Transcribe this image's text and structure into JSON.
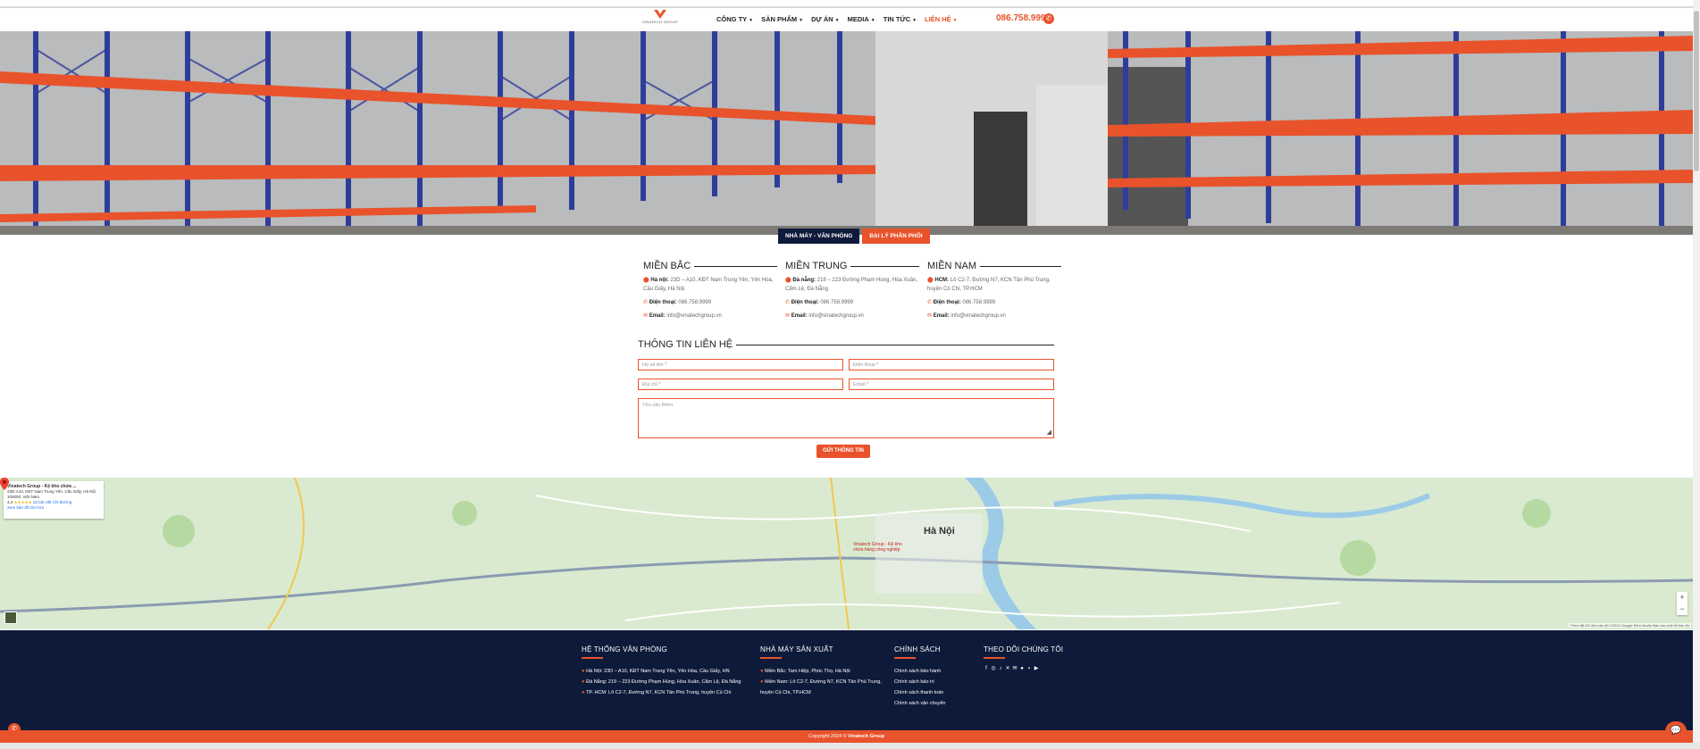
{
  "header": {
    "logo_name": "VINATECH GROUP",
    "nav": [
      {
        "label": "CÔNG TY",
        "active": false
      },
      {
        "label": "SẢN PHẨM",
        "active": false
      },
      {
        "label": "DỰ ÁN",
        "active": false
      },
      {
        "label": "MEDIA",
        "active": false
      },
      {
        "label": "TIN TỨC",
        "active": false
      },
      {
        "label": "LIÊN HỆ",
        "active": true
      }
    ],
    "hotline": "086.758.9999"
  },
  "tabs": {
    "factory_office": "NHÀ MÁY - VĂN PHÒNG",
    "distributor": "ĐẠI LÝ PHÂN PHỐI"
  },
  "regions": [
    {
      "title": "MIỀN BẮC",
      "address_label": "Hà nội:",
      "address": "23D – A10, KĐT Nam Trung Yên, Yên Hòa, Cầu Giấy, Hà Nội",
      "phone_label": "Điện thoại:",
      "phone": "086.758.9999",
      "email_label": "Email:",
      "email": "info@vinatechgroup.vn"
    },
    {
      "title": "MIỀN TRUNG",
      "address_label": "Đà nẵng:",
      "address": "219 – 223 Đường Phạm Hùng, Hòa Xuân, Cẩm Lệ, Đà Nẵng",
      "phone_label": "Điện thoại:",
      "phone": "086.758.9999",
      "email_label": "Email:",
      "email": "info@vinatechgroup.vn"
    },
    {
      "title": "MIỀN NAM",
      "address_label": "HCM:",
      "address": "Lô C2-7, Đường N7, KCN Tân Phú Trung, huyện Củ Chi, TP.HCM",
      "phone_label": "Điện thoại:",
      "phone": "086.758.9999",
      "email_label": "Email:",
      "email": "info@vinatechgroup.vn"
    }
  ],
  "form": {
    "title": "THÔNG TIN LIÊN HỆ",
    "name_placeholder": "Họ và tên *",
    "phone_placeholder": "Điện thoại *",
    "address_placeholder": "Địa chỉ *",
    "email_placeholder": "Email *",
    "message_placeholder": "Yêu cầu thêm",
    "submit": "GỬI THÔNG TIN"
  },
  "map": {
    "card_title": "Vinatech Group - Kệ kho chứa ...",
    "card_address": "23D-A10, KĐT Nam Trung Yên, Cầu Giấy, Hà Nội 100000, Việt Nam",
    "card_rating": "4,4",
    "card_stars": "★★★★★",
    "card_reviews": "32 bài viết",
    "card_directions": "Chỉ đường",
    "card_link": "Xem bản đồ lớn hơn",
    "city": "Hà Nội",
    "pin_label": "Vinatech Group - Kệ kho chứa hàng công nghiệp",
    "attribution": "Phím tắt  Dữ liệu bản đồ ©2024 Google  Điều khoản  Báo cáo một lỗi bản đồ"
  },
  "footer": {
    "col1_title": "HỆ THỐNG VĂN PHÒNG",
    "col1_items": [
      "Hà Nội: 23D – A10, KĐT Nam Trung Yên, Yên Hòa, Cầu Giấy, HN",
      "Đà Nẵng: 219 – 223 Đường Phạm Hùng, Hòa Xuân, Cẩm Lệ, Đà Nẵng",
      "TP. HCM: Lô C2-7, Đường N7, KCN Tân Phú Trung, huyện Củ Chi"
    ],
    "col2_title": "NHÀ MÁY SẢN XUẤT",
    "col2_items": [
      "Miền Bắc: Tam Hiệp, Phúc Thọ, Hà Nội",
      "Miền Nam: Lô C2-7, Đường N7, KCN Tân Phú Trung,",
      "huyện Củ Chi, TP.HCM"
    ],
    "col3_title": "CHÍNH SÁCH",
    "col3_items": [
      "Chính sách bảo hành",
      "Chính sách bảo trì",
      "Chính sách thanh toán",
      "Chính sách vận chuyển"
    ],
    "col4_title": "THEO DÕI CHÚNG TÔI",
    "copyright_prefix": "Copyright 2024 © ",
    "copyright_brand": "Vinatech Group"
  },
  "colors": {
    "accent": "#e8532b",
    "navy": "#0e1a3a"
  }
}
